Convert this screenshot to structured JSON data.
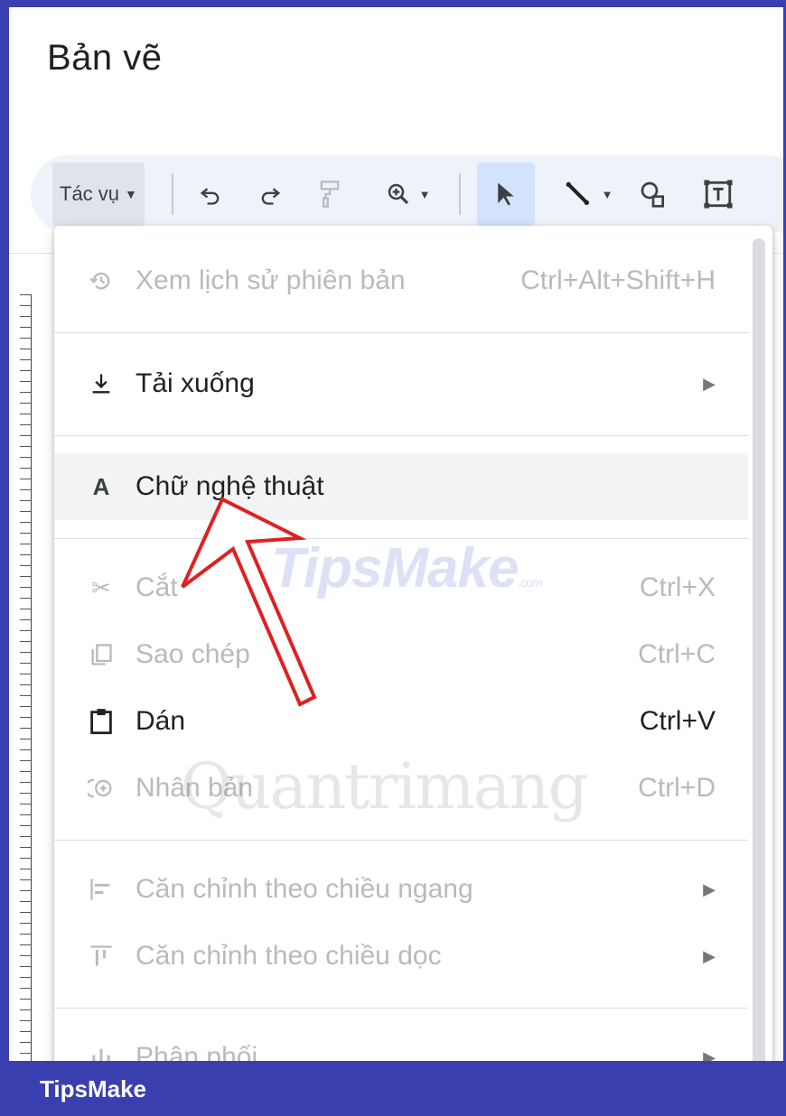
{
  "app": {
    "title": "Bản vẽ"
  },
  "toolbar": {
    "actions_label": "Tác vụ",
    "icons": [
      "undo-icon",
      "redo-icon",
      "paint-format-icon",
      "zoom-icon",
      "select-icon",
      "line-icon",
      "shape-icon",
      "text-box-icon"
    ]
  },
  "menu": {
    "items": [
      {
        "label": "Xem lịch sử phiên bản",
        "shortcut": "Ctrl+Alt+Shift+H",
        "icon": "history-icon",
        "enabled": false
      },
      {
        "label": "Tải xuống",
        "icon": "download-icon",
        "enabled": true,
        "submenu": true
      },
      {
        "label": "Chữ nghệ thuật",
        "icon": "word-art-icon",
        "enabled": true,
        "highlighted": true
      },
      {
        "label": "Cắt",
        "shortcut": "Ctrl+X",
        "icon": "scissors-icon",
        "enabled": false
      },
      {
        "label": "Sao chép",
        "shortcut": "Ctrl+C",
        "icon": "copy-icon",
        "enabled": false
      },
      {
        "label": "Dán",
        "shortcut": "Ctrl+V",
        "icon": "clipboard-icon",
        "enabled": true
      },
      {
        "label": "Nhân bản",
        "shortcut": "Ctrl+D",
        "icon": "duplicate-icon",
        "enabled": false
      },
      {
        "label": "Căn chỉnh theo chiều ngang",
        "icon": "align-horizontal-icon",
        "enabled": false,
        "submenu": true
      },
      {
        "label": "Căn chỉnh theo chiều dọc",
        "icon": "align-vertical-icon",
        "enabled": false,
        "submenu": true
      },
      {
        "label": "Phân phối",
        "icon": "distribute-icon",
        "enabled": false,
        "submenu": true
      }
    ]
  },
  "watermarks": {
    "primary": "TipsMake",
    "primary_suffix": ".com",
    "secondary": "Quantrimang"
  },
  "footer": {
    "brand": "TipsMake"
  },
  "colors": {
    "frame": "#3a3fb0",
    "highlight": "#f1f3f4",
    "selected_tool": "#d3e3fd",
    "arrow": "#e02020"
  }
}
